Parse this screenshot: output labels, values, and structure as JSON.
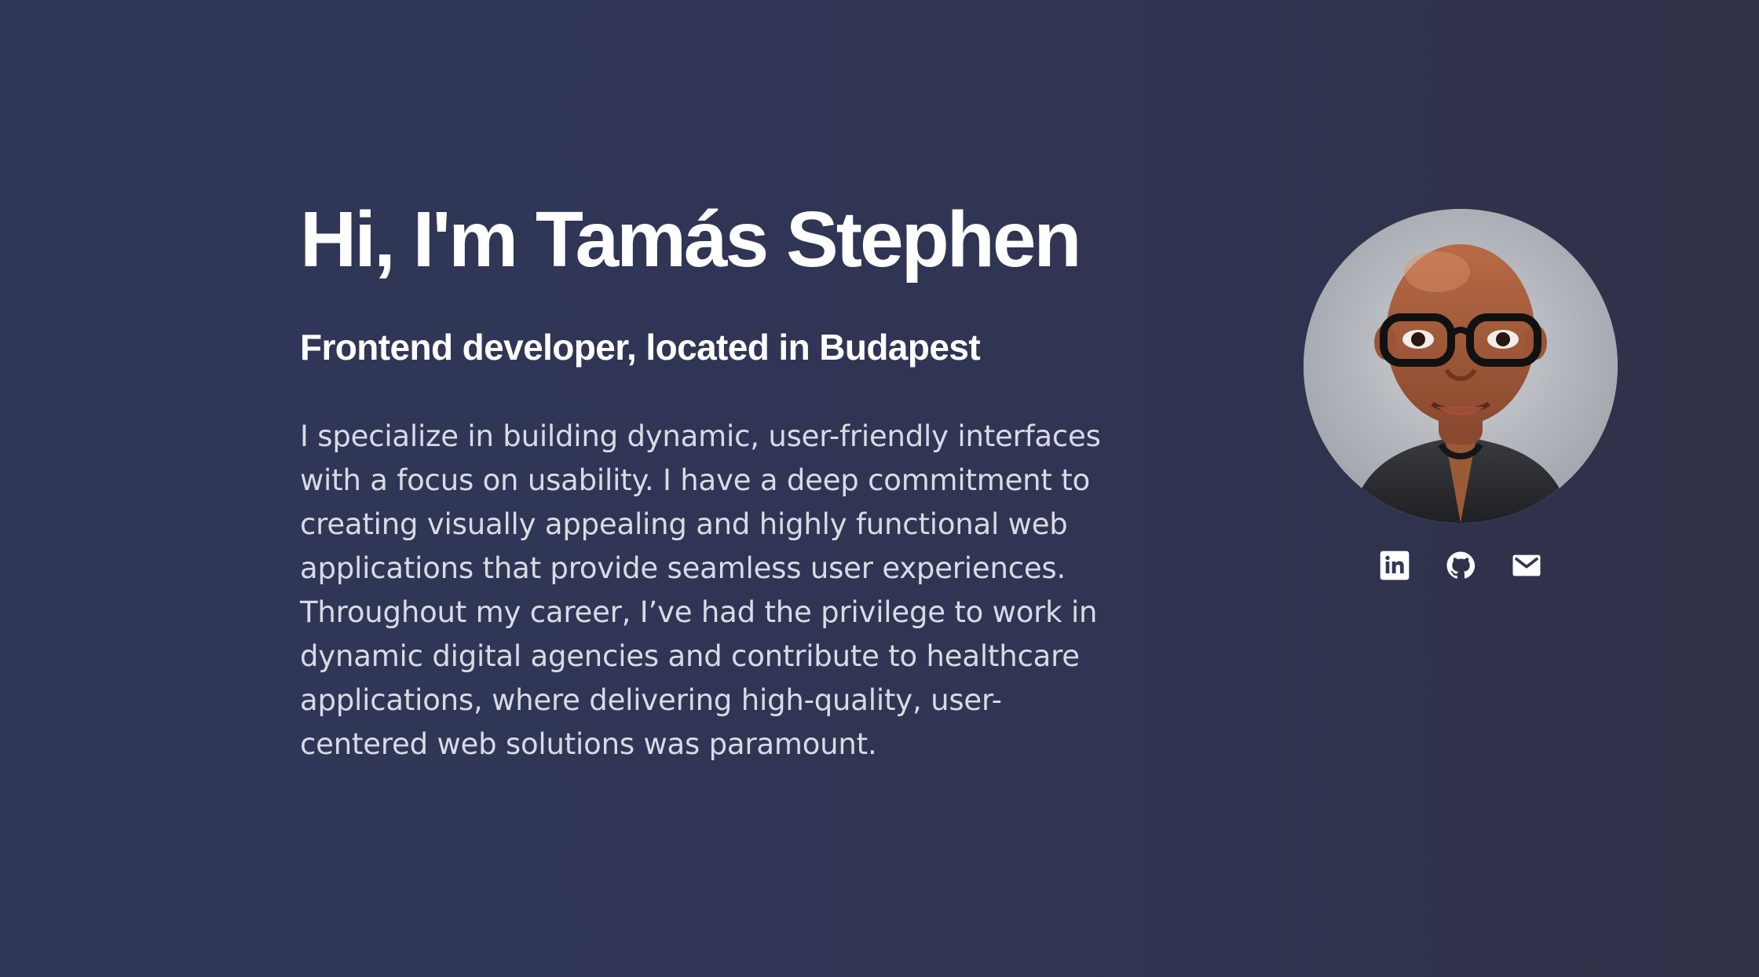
{
  "hero": {
    "title": "Hi, I'm Tamás Stephen",
    "subtitle": "Frontend developer, located in Budapest",
    "bio": "I specialize in building dynamic, user-friendly interfaces with a focus on usability. I have a deep commitment to creating visually appealing and highly functional web applications that provide seamless user experiences. Throughout my career, I’ve had the privilege to work in dynamic digital agencies and contribute to healthcare applications, where delivering high-quality, user-centered web solutions was paramount."
  },
  "profile": {
    "avatar_icon": "avatar-portrait",
    "social_links": [
      {
        "icon": "linkedin-icon"
      },
      {
        "icon": "github-icon"
      },
      {
        "icon": "mail-icon"
      }
    ]
  },
  "colors": {
    "background_left": "#2f3658",
    "background_right": "#2f3148",
    "heading": "#ffffff",
    "body_text": "#d9dbe3",
    "icon": "#ffffff"
  }
}
